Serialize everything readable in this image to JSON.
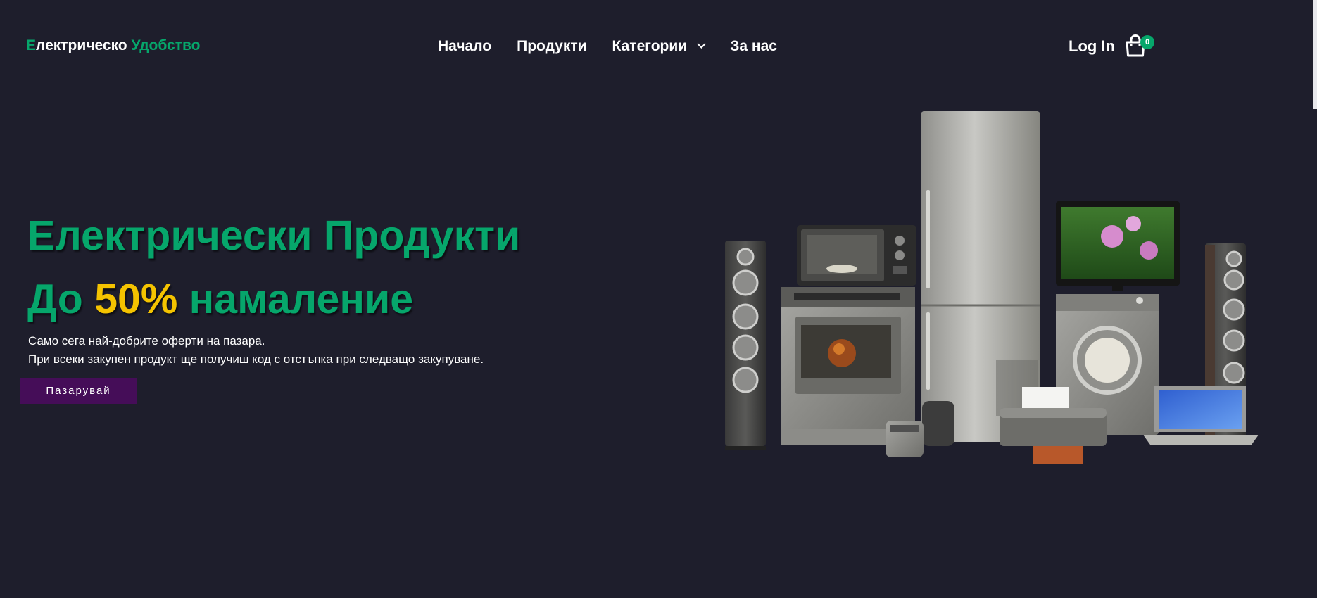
{
  "header": {
    "logo": {
      "first_letter": "Е",
      "first_rest": "лектрическо ",
      "second_word": "Удобство"
    },
    "nav": [
      {
        "label": "Начало"
      },
      {
        "label": "Продукти"
      },
      {
        "label": "Категории"
      },
      {
        "label": "За нас"
      }
    ],
    "login_label": "Log In",
    "cart_count": "0"
  },
  "hero": {
    "title": "Електрически Продукти",
    "subtitle_pre": "До ",
    "subtitle_accent": "50%",
    "subtitle_post": " намаление",
    "desc_line1": "Само сега най-добрите оферти на пазара.",
    "desc_line2": "При всеки закупен продукт ще получиш код с отстъпка при следващо закупуване.",
    "button_label": "Пазарувай"
  },
  "colors": {
    "background": "#1e1e2c",
    "brand_green": "#06a66b",
    "accent_yellow": "#f4c300",
    "button_purple": "#450d58"
  },
  "icons": {
    "cart": "shopping-bag-icon",
    "dropdown": "chevron-down-icon"
  }
}
